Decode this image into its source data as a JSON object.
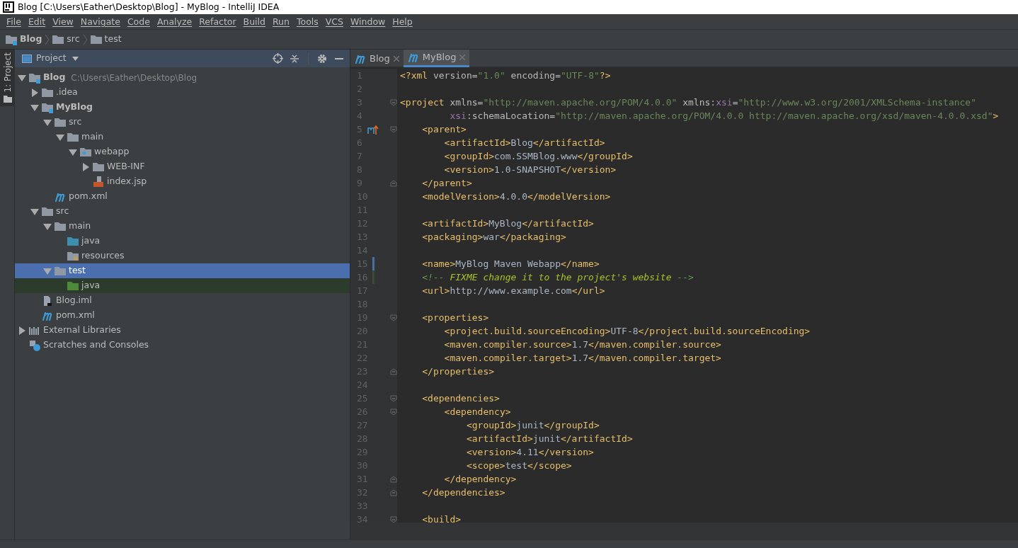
{
  "window": {
    "title": "Blog [C:\\Users\\Eather\\Desktop\\Blog] - MyBlog - IntelliJ IDEA"
  },
  "menu": [
    "File",
    "Edit",
    "View",
    "Navigate",
    "Code",
    "Analyze",
    "Refactor",
    "Build",
    "Run",
    "Tools",
    "VCS",
    "Window",
    "Help"
  ],
  "breadcrumbs": [
    {
      "label": "Blog",
      "kind": "module"
    },
    {
      "label": "src",
      "kind": "folder"
    },
    {
      "label": "test",
      "kind": "folder"
    }
  ],
  "side_tool": {
    "label": "1: Project",
    "selected": true
  },
  "project_panel": {
    "title": "Project",
    "tree": [
      {
        "label": "Blog",
        "path": "C:\\Users\\Eather\\Desktop\\Blog",
        "kind": "module",
        "bold": true,
        "expanded": true,
        "selected": false,
        "children": [
          {
            "label": ".idea",
            "kind": "folder",
            "expanded": false,
            "selected": false
          },
          {
            "label": "MyBlog",
            "kind": "module",
            "bold": true,
            "expanded": true,
            "selected": false,
            "children": [
              {
                "label": "src",
                "kind": "folder",
                "expanded": true,
                "selected": false,
                "children": [
                  {
                    "label": "main",
                    "kind": "folder",
                    "expanded": true,
                    "selected": false,
                    "children": [
                      {
                        "label": "webapp",
                        "kind": "web",
                        "expanded": true,
                        "selected": false,
                        "children": [
                          {
                            "label": "WEB-INF",
                            "kind": "folder",
                            "expanded": false,
                            "selected": false
                          },
                          {
                            "label": "index.jsp",
                            "kind": "jsp",
                            "selected": false
                          }
                        ]
                      }
                    ]
                  }
                ]
              },
              {
                "label": "pom.xml",
                "kind": "maven",
                "selected": false
              }
            ]
          },
          {
            "label": "src",
            "kind": "folder",
            "expanded": true,
            "selected": false,
            "children": [
              {
                "label": "main",
                "kind": "folder",
                "expanded": true,
                "selected": false,
                "children": [
                  {
                    "label": "java",
                    "kind": "source",
                    "selected": false
                  },
                  {
                    "label": "resources",
                    "kind": "resources",
                    "selected": false
                  }
                ]
              },
              {
                "label": "test",
                "kind": "folder",
                "expanded": true,
                "selected": true,
                "children": [
                  {
                    "label": "java",
                    "kind": "test",
                    "selected": false,
                    "highlighted": true
                  }
                ]
              }
            ]
          },
          {
            "label": "Blog.iml",
            "kind": "iml",
            "selected": false
          },
          {
            "label": "pom.xml",
            "kind": "maven",
            "selected": false
          }
        ]
      },
      {
        "label": "External Libraries",
        "kind": "libraries",
        "expanded": false,
        "selected": false
      },
      {
        "label": "Scratches and Consoles",
        "kind": "scratches",
        "selected": false
      }
    ]
  },
  "editor_tabs": [
    {
      "label": "Blog",
      "selected": false
    },
    {
      "label": "MyBlog",
      "selected": true
    }
  ],
  "code_lines": [
    {
      "number": "1",
      "tokens": [
        {
          "kind": "tag",
          "text": "<?xml "
        },
        {
          "kind": "attr",
          "text": "version="
        },
        {
          "kind": "string",
          "text": "\"1.0\""
        },
        {
          "kind": "attr",
          "text": " encoding="
        },
        {
          "kind": "string",
          "text": "\"UTF-8\""
        },
        {
          "kind": "tag",
          "text": "?>"
        }
      ]
    },
    {
      "number": "2"
    },
    {
      "number": "3",
      "fold_start": true,
      "tokens": [
        {
          "kind": "tag",
          "text": "<project "
        },
        {
          "kind": "attr",
          "text": "xmlns="
        },
        {
          "kind": "string",
          "text": "\"http://maven.apache.org/POM/4.0.0\""
        },
        {
          "kind": "attr",
          "text": " xmlns:"
        },
        {
          "kind": "ns",
          "text": "xsi"
        },
        {
          "kind": "attr",
          "text": "="
        },
        {
          "kind": "string",
          "text": "\"http://www.w3.org/2001/XMLSchema-instance\""
        }
      ]
    },
    {
      "number": "4",
      "continuation": true,
      "tokens": [
        {
          "kind": "ns",
          "text": "xsi"
        },
        {
          "kind": "attr",
          "text": ":schemaLocation="
        },
        {
          "kind": "string",
          "text": "\"http://maven.apache.org/POM/4.0.0 http://maven.apache.org/xsd/maven-4.0.0.xsd\""
        },
        {
          "kind": "tag",
          "text": ">"
        }
      ]
    },
    {
      "number": "5",
      "fold_start": true,
      "override_marker": true,
      "tokens": [
        {
          "kind": "tag",
          "text": "<parent>"
        }
      ]
    },
    {
      "number": "6",
      "tokens": [
        {
          "kind": "tag",
          "text": "<artifactId>"
        },
        {
          "kind": "text",
          "text": "Blog"
        },
        {
          "kind": "tag",
          "text": "</artifactId>"
        }
      ]
    },
    {
      "number": "7",
      "tokens": [
        {
          "kind": "tag",
          "text": "<groupId>"
        },
        {
          "kind": "text",
          "text": "com.SSMBlog.www"
        },
        {
          "kind": "tag",
          "text": "</groupId>"
        }
      ]
    },
    {
      "number": "8",
      "tokens": [
        {
          "kind": "tag",
          "text": "<version>"
        },
        {
          "kind": "text",
          "text": "1.0-SNAPSHOT"
        },
        {
          "kind": "tag",
          "text": "</version>"
        }
      ]
    },
    {
      "number": "9",
      "fold_end": true,
      "tokens": [
        {
          "kind": "tag",
          "text": "</parent>"
        }
      ]
    },
    {
      "number": "10",
      "tokens": [
        {
          "kind": "tag",
          "text": "<modelVersion>"
        },
        {
          "kind": "text",
          "text": "4.0.0"
        },
        {
          "kind": "tag",
          "text": "</modelVersion>"
        }
      ]
    },
    {
      "number": "11"
    },
    {
      "number": "12",
      "tokens": [
        {
          "kind": "tag",
          "text": "<artifactId>"
        },
        {
          "kind": "text",
          "text": "MyBlog"
        },
        {
          "kind": "tag",
          "text": "</artifactId>"
        }
      ]
    },
    {
      "number": "13",
      "tokens": [
        {
          "kind": "tag",
          "text": "<packaging>"
        },
        {
          "kind": "text",
          "text": "war"
        },
        {
          "kind": "tag",
          "text": "</packaging>"
        }
      ]
    },
    {
      "number": "14"
    },
    {
      "number": "15",
      "modified": true,
      "tokens": [
        {
          "kind": "tag",
          "text": "<name>"
        },
        {
          "kind": "text",
          "text": "MyBlog Maven Webapp"
        },
        {
          "kind": "tag",
          "text": "</name>"
        }
      ]
    },
    {
      "number": "16",
      "added": true,
      "tokens": [
        {
          "kind": "comment",
          "text": "<!-- "
        },
        {
          "kind": "todo",
          "text": "FIXME change it to the project's website"
        },
        {
          "kind": "comment",
          "text": " -->"
        }
      ]
    },
    {
      "number": "17",
      "tokens": [
        {
          "kind": "tag",
          "text": "<url>"
        },
        {
          "kind": "text",
          "text": "http://www.example.com"
        },
        {
          "kind": "tag",
          "text": "</url>"
        }
      ]
    },
    {
      "number": "18"
    },
    {
      "number": "19",
      "fold_start": true,
      "tokens": [
        {
          "kind": "tag",
          "text": "<properties>"
        }
      ]
    },
    {
      "number": "20",
      "tokens": [
        {
          "kind": "tag",
          "text": "<project.build.sourceEncoding>"
        },
        {
          "kind": "text",
          "text": "UTF-8"
        },
        {
          "kind": "tag",
          "text": "</project.build.sourceEncoding>"
        }
      ]
    },
    {
      "number": "21",
      "tokens": [
        {
          "kind": "tag",
          "text": "<maven.compiler.source>"
        },
        {
          "kind": "text",
          "text": "1.7"
        },
        {
          "kind": "tag",
          "text": "</maven.compiler.source>"
        }
      ]
    },
    {
      "number": "22",
      "tokens": [
        {
          "kind": "tag",
          "text": "<maven.compiler.target>"
        },
        {
          "kind": "text",
          "text": "1.7"
        },
        {
          "kind": "tag",
          "text": "</maven.compiler.target>"
        }
      ]
    },
    {
      "number": "23",
      "fold_end": true,
      "tokens": [
        {
          "kind": "tag",
          "text": "</properties>"
        }
      ]
    },
    {
      "number": "24"
    },
    {
      "number": "25",
      "fold_start": true,
      "tokens": [
        {
          "kind": "tag",
          "text": "<dependencies>"
        }
      ]
    },
    {
      "number": "26",
      "fold_start": true,
      "tokens": [
        {
          "kind": "tag",
          "text": "<dependency>"
        }
      ]
    },
    {
      "number": "27",
      "tokens": [
        {
          "kind": "tag",
          "text": "<groupId>"
        },
        {
          "kind": "text",
          "text": "junit"
        },
        {
          "kind": "tag",
          "text": "</groupId>"
        }
      ]
    },
    {
      "number": "28",
      "tokens": [
        {
          "kind": "tag",
          "text": "<artifactId>"
        },
        {
          "kind": "text",
          "text": "junit"
        },
        {
          "kind": "tag",
          "text": "</artifactId>"
        }
      ]
    },
    {
      "number": "29",
      "tokens": [
        {
          "kind": "tag",
          "text": "<version>"
        },
        {
          "kind": "text",
          "text": "4.11"
        },
        {
          "kind": "tag",
          "text": "</version>"
        }
      ]
    },
    {
      "number": "30",
      "tokens": [
        {
          "kind": "tag",
          "text": "<scope>"
        },
        {
          "kind": "text",
          "text": "test"
        },
        {
          "kind": "tag",
          "text": "</scope>"
        }
      ]
    },
    {
      "number": "31",
      "fold_end": true,
      "tokens": [
        {
          "kind": "tag",
          "text": "</dependency>"
        }
      ]
    },
    {
      "number": "32",
      "fold_end": true,
      "tokens": [
        {
          "kind": "tag",
          "text": "</dependencies>"
        }
      ]
    },
    {
      "number": "33"
    },
    {
      "number": "34",
      "fold_start": true,
      "tokens": [
        {
          "kind": "tag",
          "text": "<build>"
        }
      ]
    }
  ]
}
